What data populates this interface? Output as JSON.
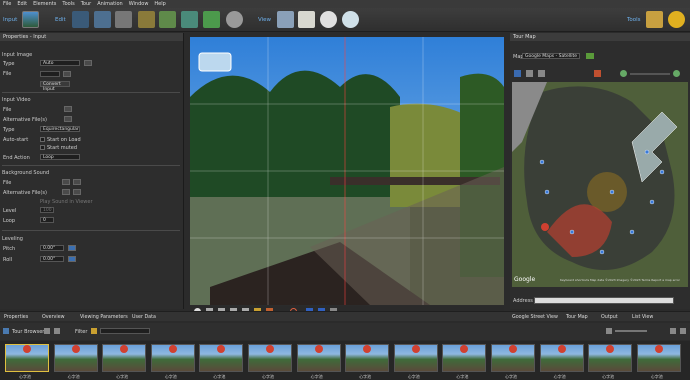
{
  "menu": [
    "File",
    "Edit",
    "Elements",
    "Tools",
    "Tour",
    "Animation",
    "Window",
    "Help"
  ],
  "toolbar": {
    "input": "Input",
    "edit": "Edit",
    "view": "View",
    "tools": "Tools"
  },
  "props": {
    "title": "Properties - Input",
    "input_image": "Input Image",
    "type_label": "Type",
    "type_value": "Auto",
    "file_label": "File",
    "convert": "Convert Input",
    "input_video": "Input Video",
    "file2": "File",
    "alt_files": "Alternative File(s)",
    "type2": "Type",
    "type2_value": "Equirectangular",
    "autostart": "Auto-start",
    "start_on_load": "Start on Load",
    "start_muted": "Start muted",
    "end_action": "End Action",
    "end_value": "Loop",
    "bg_sound": "Background Sound",
    "file3": "File",
    "alt_files3": "Alternative File(s)",
    "play_label": "Play Sound in Viewer",
    "level": "Level",
    "level_value": "100",
    "loop": "Loop",
    "loop_value": "0",
    "leveling": "Leveling",
    "pitch": "Pitch",
    "pitch_value": "0.00°",
    "roll": "Roll",
    "roll_value": "0.00°"
  },
  "map": {
    "title": "Tour Map",
    "map_label": "Map",
    "map_value": "Google Maps - Satellite",
    "attribution": "Keyboard shortcuts  Map data ©2023 Imagery ©2023  Terms  Report a map error",
    "google": "Google",
    "address_label": "Address"
  },
  "tabs": {
    "properties": "Properties",
    "overview": "Overview",
    "viewing": "Viewing Parameters",
    "userdata": "User Data",
    "street": "Google Street View",
    "tourmap": "Tour Map",
    "output": "Output",
    "list": "List View"
  },
  "browser": {
    "title": "Tour Browser",
    "filter": "Filter"
  },
  "thumbs": [
    "心字池",
    "心字池",
    "心字池",
    "心字池",
    "心字池",
    "心字池",
    "心字池",
    "心字池",
    "心字池",
    "心字池",
    "心字池",
    "心字池",
    "心字池",
    "心字池"
  ]
}
